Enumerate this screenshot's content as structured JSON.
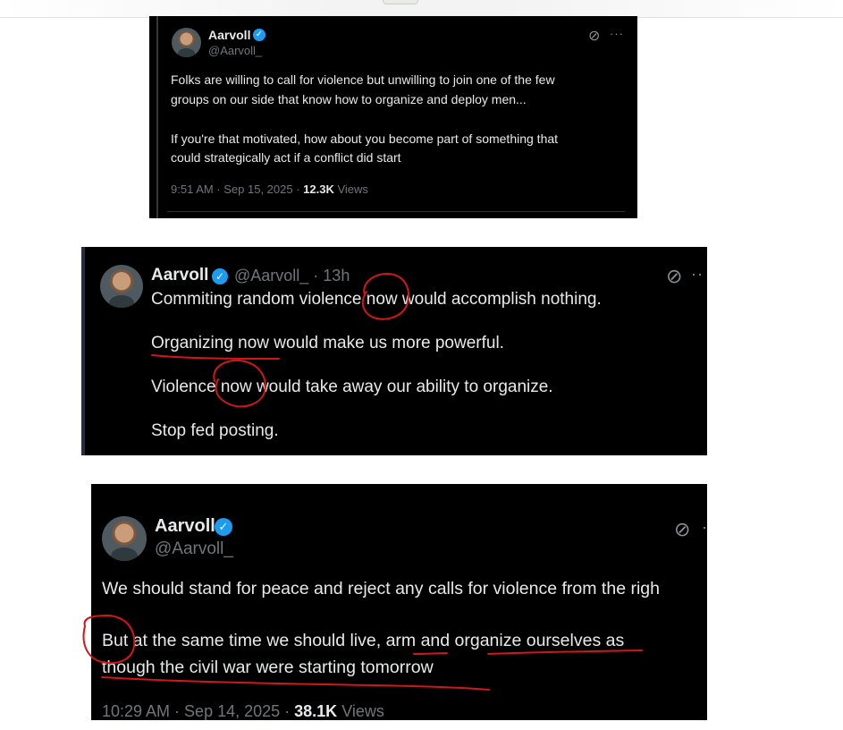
{
  "tweets": [
    {
      "name": "Aarvoll",
      "handle": "@Aarvoll_",
      "lines": [
        "Folks are willing to call for violence but unwilling to join one of the few",
        "groups on our side that know how to organize and deploy men...",
        "If you're that motivated, how about you become part of something that",
        "could strategically act if a conflict did start"
      ],
      "time": "9:51 AM · Sep 15, 2025 · ",
      "views_count": "12.3K",
      "views_label": " Views"
    },
    {
      "name": "Aarvoll",
      "handle": "@Aarvoll_ · 13h",
      "lines": [
        "Commiting random violence now would accomplish nothing.",
        "Organizing now would make us more powerful.",
        "Violence now would take away our ability to organize.",
        "Stop fed posting."
      ]
    },
    {
      "name": "Aarvoll",
      "handle": "@Aarvoll_",
      "lines": [
        "We should stand for peace and reject any calls for violence from the righ",
        "But at the same time we should live, arm and organize ourselves as",
        "though the civil war were starting tomorrow"
      ],
      "time": "10:29 AM · Sep 14, 2025 · ",
      "views_count": "38.1K",
      "views_label": " Views"
    }
  ],
  "icons": {
    "verified": "verified-badge-icon",
    "grok": "grok-icon",
    "more": "more-icon"
  },
  "colors": {
    "background": "#000000",
    "text": "#e7e9ea",
    "muted": "#71767b",
    "verified": "#1d9bf0",
    "annotation": "#d01818"
  }
}
